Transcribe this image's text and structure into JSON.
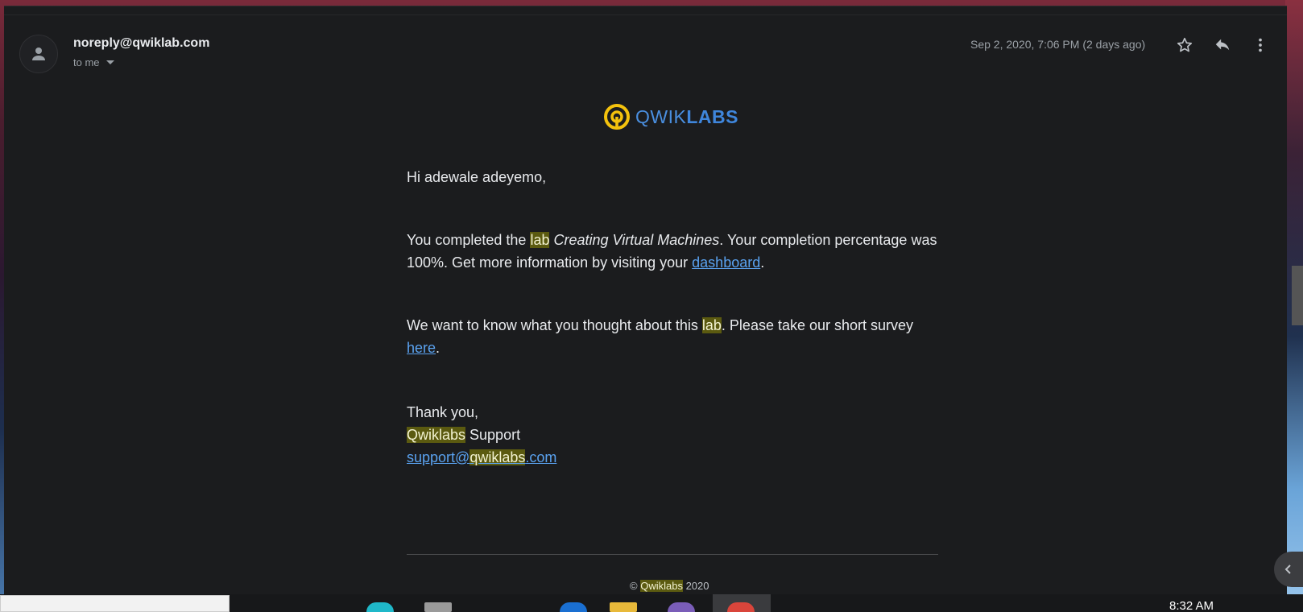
{
  "email": {
    "sender": "noreply@qwiklab.com",
    "recipient": "to me",
    "date": "Sep 2, 2020, 7:06 PM (2 days ago)"
  },
  "logo": {
    "part1": "QWIK",
    "part2": "LABS"
  },
  "body": {
    "greeting": "Hi adewale adeyemo,",
    "p1_before": "You completed the ",
    "p1_hl": "lab",
    "p1_space": " ",
    "p1_title": "Creating Virtual Machines",
    "p1_after": ". Your completion percentage was 100%. Get more information by visiting your ",
    "p1_link": "dashboard",
    "p1_end": ".",
    "p2_before": "We want to know what you thought about this ",
    "p2_hl": "lab",
    "p2_after": ". Please take our short survey ",
    "p2_link": "here",
    "p2_end": ".",
    "thanks": "Thank you,",
    "sig_hl": "Qwiklabs",
    "sig_rest": " Support",
    "email_pre": "support@",
    "email_hl": "qwiklabs",
    "email_post": ".com"
  },
  "footer": {
    "copyright": "©",
    "brand": "Qwiklabs",
    "year": " 2020"
  },
  "taskbar": {
    "time": "8:32 AM"
  },
  "colors": {
    "background": "#1b1c1e",
    "link": "#5aa2f0",
    "highlight": "#5b5a10",
    "logo_yellow": "#f4c20d",
    "logo_blue": "#3f86dc"
  }
}
